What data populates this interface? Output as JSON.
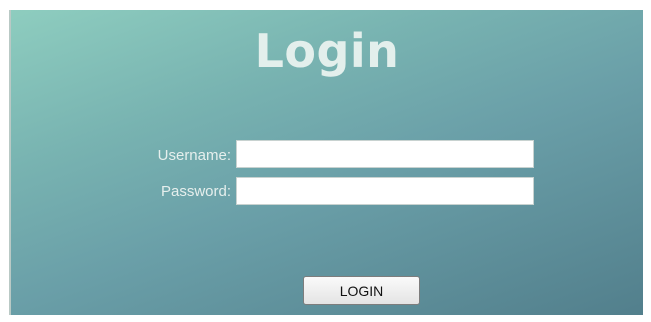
{
  "form": {
    "title": "Login",
    "username_label": "Username:",
    "username_value": "",
    "password_label": "Password:",
    "password_value": "",
    "submit_label": "LOGIN"
  }
}
